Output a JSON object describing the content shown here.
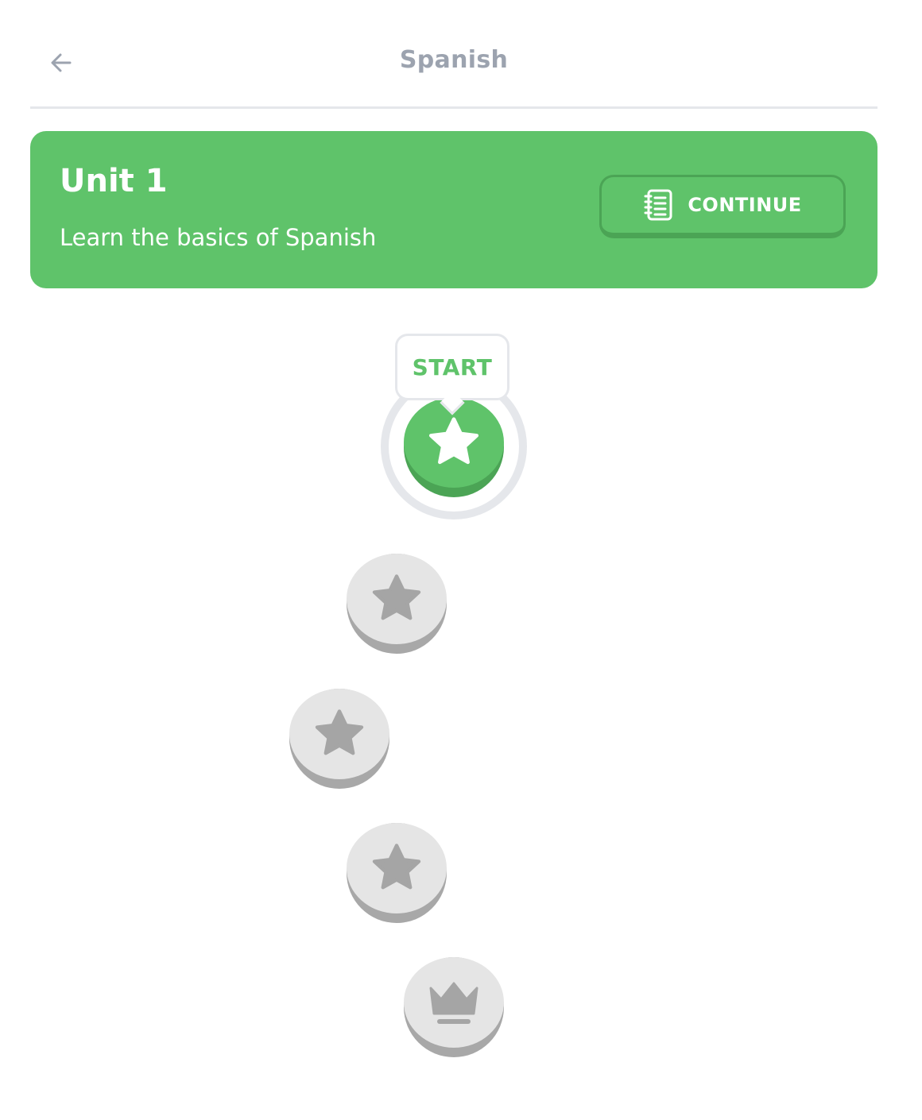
{
  "header": {
    "title": "Spanish",
    "back_icon": "arrow-left-icon"
  },
  "unit": {
    "title": "Unit 1",
    "subtitle": "Learn the basics of Spanish",
    "continue_label": "CONTINUE",
    "continue_icon": "notebook-icon",
    "color": "#5fc36a"
  },
  "path": {
    "start_label": "START",
    "nodes": [
      {
        "type": "star",
        "state": "active"
      },
      {
        "type": "star",
        "state": "locked"
      },
      {
        "type": "star",
        "state": "locked"
      },
      {
        "type": "star",
        "state": "locked"
      },
      {
        "type": "crown",
        "state": "locked"
      }
    ],
    "colors": {
      "active": "#5fc36a",
      "locked": "#e5e5e5",
      "locked_icon": "#a5a5a5"
    }
  }
}
